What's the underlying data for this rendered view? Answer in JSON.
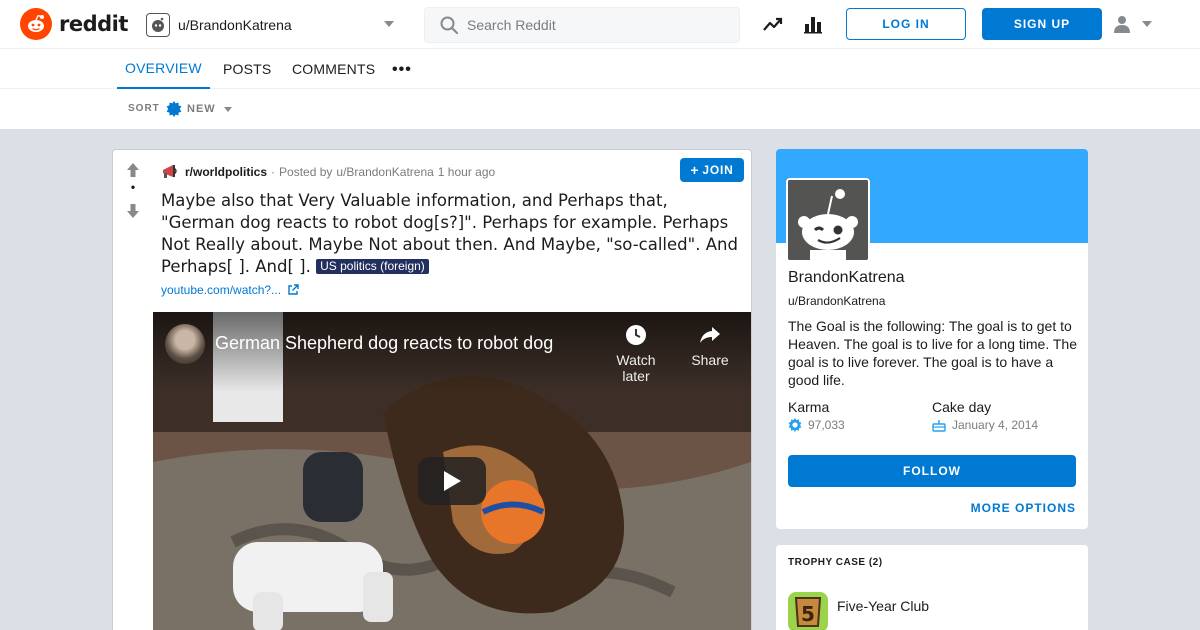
{
  "header": {
    "logo_text": "reddit",
    "user_dropdown_label": "u/BrandonKatrena",
    "search_placeholder": "Search Reddit",
    "login_label": "LOG IN",
    "signup_label": "SIGN UP"
  },
  "tabs": [
    {
      "label": "OVERVIEW",
      "active": true
    },
    {
      "label": "POSTS",
      "active": false
    },
    {
      "label": "COMMENTS",
      "active": false
    }
  ],
  "tabs_more": "•••",
  "sort": {
    "label": "SORT",
    "value": "NEW"
  },
  "post": {
    "subreddit": "r/worldpolitics",
    "posted_by_prefix": "Posted by",
    "author": "u/BrandonKatrena",
    "time": "1 hour ago",
    "vote_count": "•",
    "join_label": "JOIN",
    "title": "Maybe also that Very Valuable information, and Perhaps that, \"German dog reacts to robot dog[s?]\". Perhaps for example. Perhaps Not Really about. Maybe Not about then. And Maybe, \"so-called\". And Perhaps[ ]. And[ ].",
    "flair": "US politics (foreign)",
    "flair_color": "#222f5f",
    "link_text": "youtube.com/watch?...",
    "video": {
      "title": "German Shepherd dog reacts to robot dog",
      "watch_later_label": "Watch later",
      "share_label": "Share"
    }
  },
  "profile": {
    "display_name": "BrandonKatrena",
    "username": "u/BrandonKatrena",
    "description": "The Goal is the following: The goal is to get to Heaven. The goal is to live for a long time. The goal is to live forever. The goal is to have a good life.",
    "karma_label": "Karma",
    "karma_value": "97,033",
    "cake_label": "Cake day",
    "cake_value": "January 4, 2014",
    "follow_label": "FOLLOW",
    "more_options_label": "MORE OPTIONS",
    "banner_color": "#33a8ff"
  },
  "trophy": {
    "header": "TROPHY CASE (2)",
    "items": [
      {
        "name": "Five-Year Club",
        "icon": "five-year-club-icon"
      }
    ]
  },
  "colors": {
    "accent": "#0079d3",
    "brand": "#ff4500",
    "background": "#dae0e6"
  }
}
